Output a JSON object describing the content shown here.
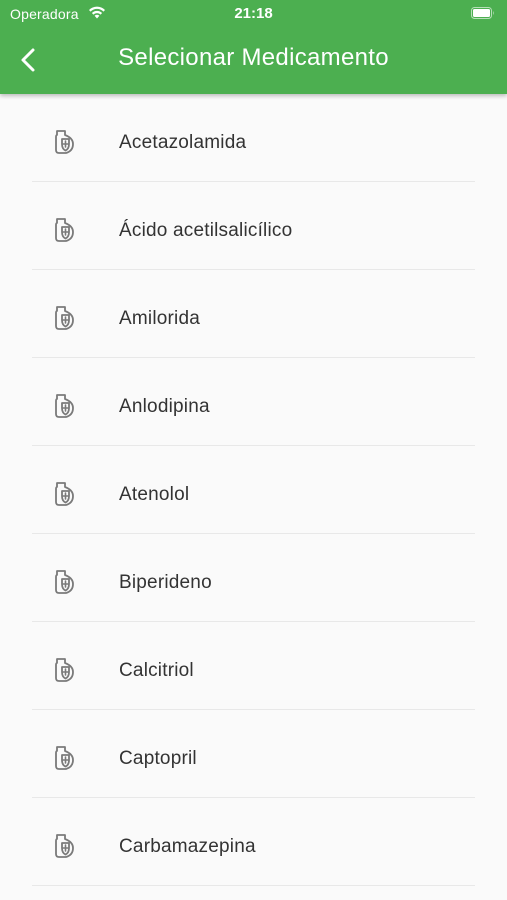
{
  "status_bar": {
    "carrier": "Operadora",
    "time": "21:18"
  },
  "header": {
    "title": "Selecionar Medicamento",
    "back_icon": "chevron-left-icon",
    "background_color": "#4caf50"
  },
  "medications": {
    "icon": "medicine-bottle-icon",
    "items": [
      "Acetazolamida",
      "Ácido acetilsalicílico",
      "Amilorida",
      "Anlodipina",
      "Atenolol",
      "Biperideno",
      "Calcitriol",
      "Captopril",
      "Carbamazepina"
    ]
  }
}
